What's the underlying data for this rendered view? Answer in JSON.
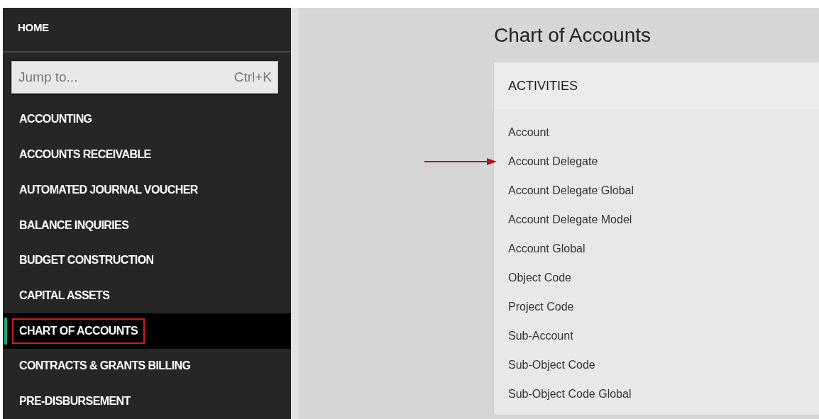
{
  "sidebar": {
    "home": "HOME",
    "jump": {
      "placeholder": "Jump to...",
      "shortcut": "Ctrl+K"
    },
    "items": [
      {
        "label": "ACCOUNTING",
        "selected": false,
        "highlighted": false
      },
      {
        "label": "ACCOUNTS RECEIVABLE",
        "selected": false,
        "highlighted": false
      },
      {
        "label": "AUTOMATED JOURNAL VOUCHER",
        "selected": false,
        "highlighted": false
      },
      {
        "label": "BALANCE INQUIRIES",
        "selected": false,
        "highlighted": false
      },
      {
        "label": "BUDGET CONSTRUCTION",
        "selected": false,
        "highlighted": false
      },
      {
        "label": "CAPITAL ASSETS",
        "selected": false,
        "highlighted": false
      },
      {
        "label": "CHART OF ACCOUNTS",
        "selected": true,
        "highlighted": true
      },
      {
        "label": "CONTRACTS & GRANTS BILLING",
        "selected": false,
        "highlighted": false
      },
      {
        "label": "PRE-DISBURSEMENT",
        "selected": false,
        "highlighted": false
      }
    ]
  },
  "main": {
    "title": "Chart of Accounts",
    "card": {
      "heading": "ACTIVITIES",
      "links": [
        {
          "label": "Account",
          "pointed": false
        },
        {
          "label": "Account Delegate",
          "pointed": true
        },
        {
          "label": "Account Delegate Global",
          "pointed": false
        },
        {
          "label": "Account Delegate Model",
          "pointed": false
        },
        {
          "label": "Account Global",
          "pointed": false
        },
        {
          "label": "Object Code",
          "pointed": false
        },
        {
          "label": "Project Code",
          "pointed": false
        },
        {
          "label": "Sub-Account",
          "pointed": false
        },
        {
          "label": "Sub-Object Code",
          "pointed": false
        },
        {
          "label": "Sub-Object Code Global",
          "pointed": false
        }
      ]
    }
  }
}
